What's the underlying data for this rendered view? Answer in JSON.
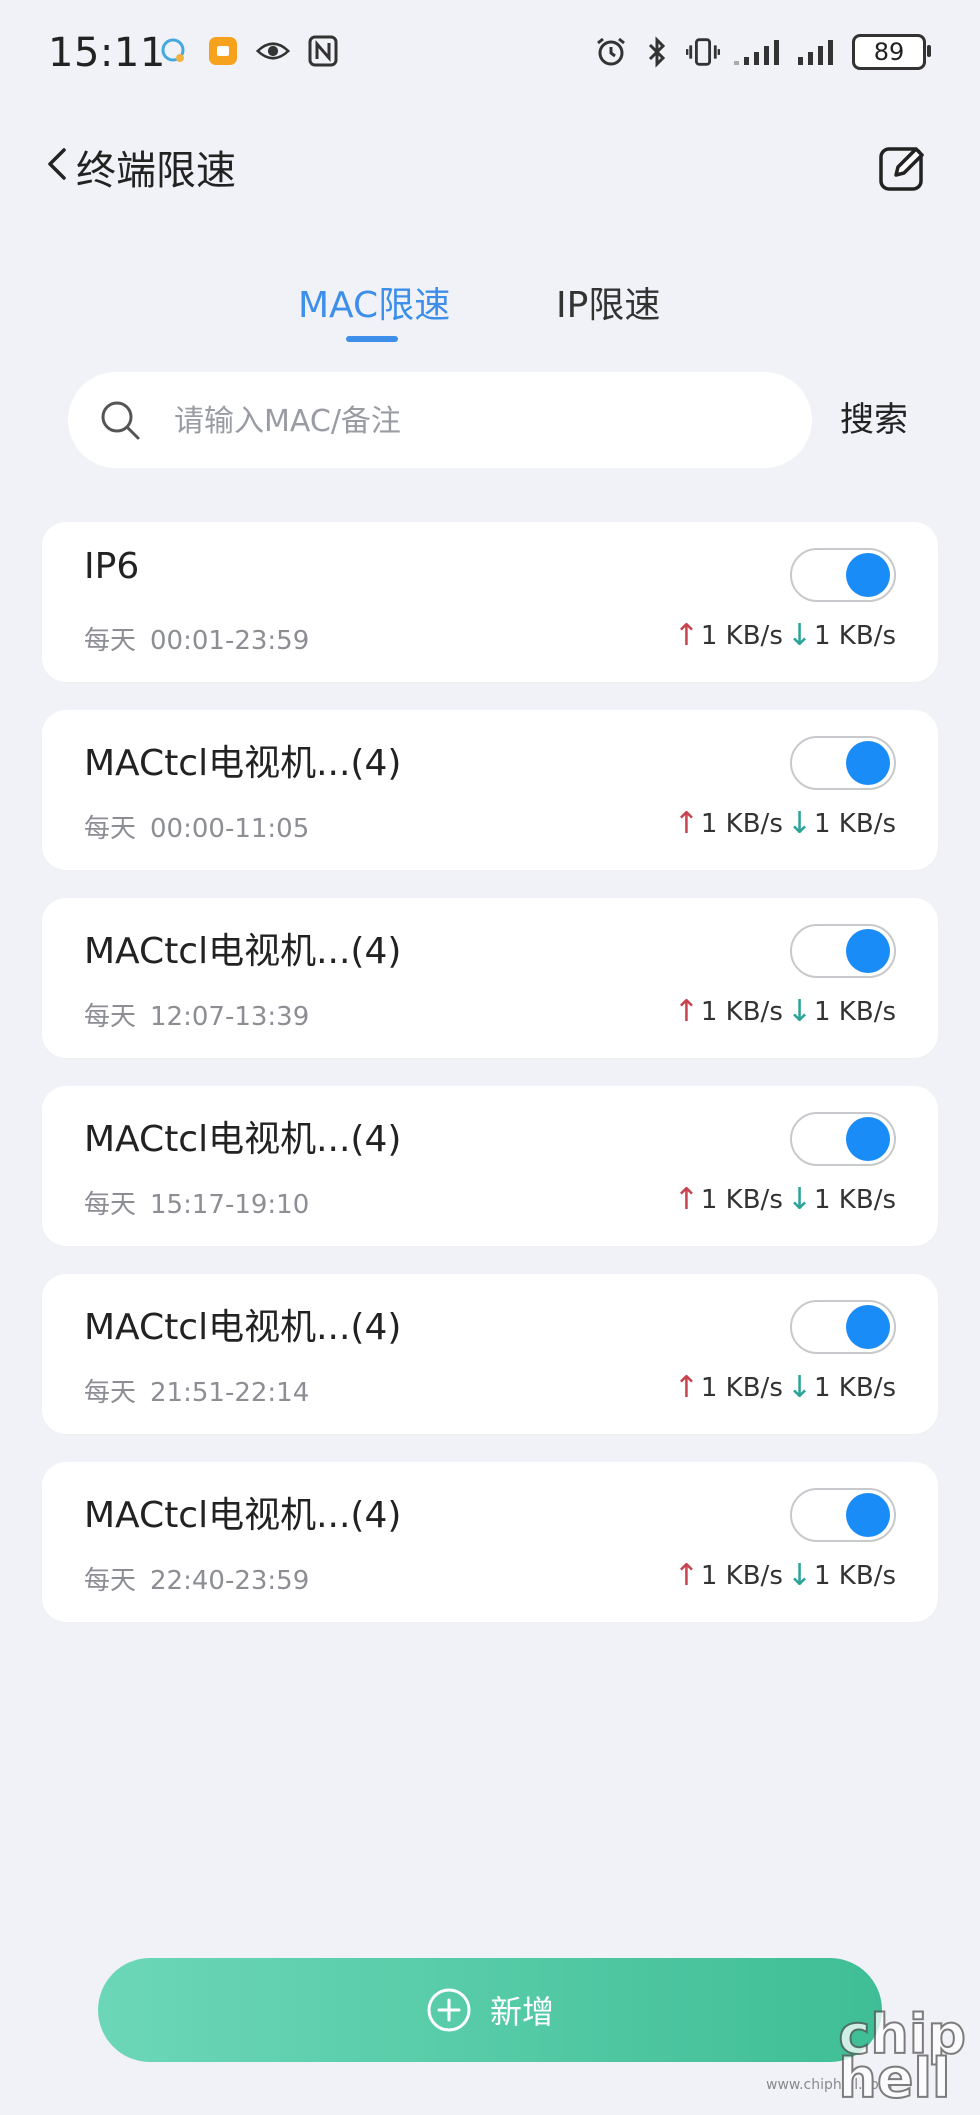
{
  "status_bar": {
    "time": "15:11",
    "battery": "89",
    "left_icons": [
      "chat-bubble-icon",
      "app-badge-icon",
      "eye-icon",
      "nfc-icon"
    ],
    "right_icons": [
      "alarm-icon",
      "bluetooth-icon",
      "vibrate-icon",
      "signal-weak-icon",
      "signal-strong-icon"
    ]
  },
  "header": {
    "title": "终端限速",
    "back_icon": "chevron-left-icon",
    "edit_icon": "edit-icon"
  },
  "tabs": [
    {
      "label": "MAC限速",
      "active": true
    },
    {
      "label": "IP限速",
      "active": false
    }
  ],
  "search": {
    "placeholder": "请输入MAC/备注",
    "value": "",
    "button_label": "搜索"
  },
  "rules": [
    {
      "name": "IP6",
      "days": "每天",
      "time": "00:01-23:59",
      "upload": "1 KB/s",
      "download": "1 KB/s",
      "enabled": true
    },
    {
      "name": "MACtcl电视机...(4)",
      "days": "每天",
      "time": "00:00-11:05",
      "upload": "1 KB/s",
      "download": "1 KB/s",
      "enabled": true
    },
    {
      "name": "MACtcl电视机...(4)",
      "days": "每天",
      "time": "12:07-13:39",
      "upload": "1 KB/s",
      "download": "1 KB/s",
      "enabled": true
    },
    {
      "name": "MACtcl电视机...(4)",
      "days": "每天",
      "time": "15:17-19:10",
      "upload": "1 KB/s",
      "download": "1 KB/s",
      "enabled": true
    },
    {
      "name": "MACtcl电视机...(4)",
      "days": "每天",
      "time": "21:51-22:14",
      "upload": "1 KB/s",
      "download": "1 KB/s",
      "enabled": true
    },
    {
      "name": "MACtcl电视机...(4)",
      "days": "每天",
      "time": "22:40-23:59",
      "upload": "1 KB/s",
      "download": "1 KB/s",
      "enabled": true
    }
  ],
  "add_button": {
    "label": "新增",
    "icon": "plus-circle-icon"
  },
  "watermark": {
    "url": "www.chiphell.com",
    "logo": "chip hell"
  },
  "colors": {
    "accent": "#3d8fea",
    "toggle_on": "#1a8cf8",
    "upload_arrow": "#c7434f",
    "download_arrow": "#2aa399",
    "add_button_start": "#6cd7b7",
    "add_button_end": "#3fbe95",
    "background": "#f1f2f7"
  }
}
